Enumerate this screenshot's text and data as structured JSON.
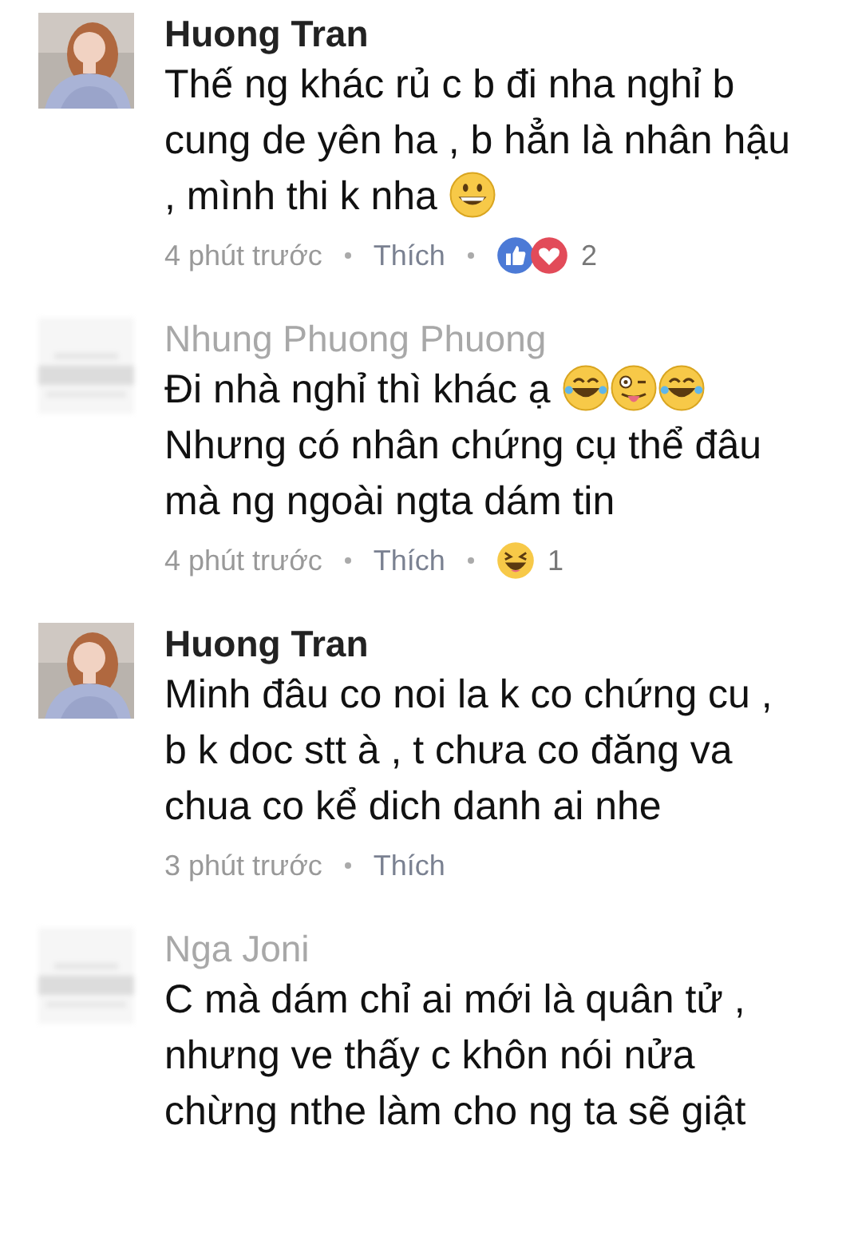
{
  "comments": [
    {
      "author": "Huong Tran",
      "blurred": false,
      "body": [
        {
          "kind": "text",
          "text": "Thế ng khác rủ c b đi nha nghỉ b cung de yên ha , b hẳn là nhân hậu , mình thi k nha "
        },
        {
          "kind": "grin"
        }
      ],
      "time": "4 phút trước",
      "like": "Thích",
      "reactions": [
        {
          "kind": "like"
        },
        {
          "kind": "love"
        }
      ],
      "count": "2"
    },
    {
      "author": "Nhung Phuong Phuong",
      "blurred": true,
      "body": [
        {
          "kind": "text",
          "text": "Đi nhà nghỉ thì khác ạ "
        },
        {
          "kind": "tears"
        },
        {
          "kind": "tongue"
        },
        {
          "kind": "tears"
        },
        {
          "kind": "text",
          "text": " Nhưng có nhân chứng cụ thể đâu mà ng ngoài ngta dám tin"
        }
      ],
      "time": "4 phút trước",
      "like": "Thích",
      "reactions": [
        {
          "kind": "haha"
        }
      ],
      "count": "1"
    },
    {
      "author": "Huong Tran",
      "blurred": false,
      "body": [
        {
          "kind": "text",
          "text": "Minh đâu co noi la k co chứng cu , b k doc stt à , t chưa co đăng va chua co kể dich danh ai nhe"
        }
      ],
      "time": "3 phút trước",
      "like": "Thích"
    },
    {
      "author": "Nga Joni",
      "blurred": true,
      "body": [
        {
          "kind": "text",
          "text": "C mà dám chỉ ai mới là quân tử , nhưng ve thấy c khôn nói nửa chừng nthe làm cho ng ta sẽ giật"
        }
      ]
    }
  ]
}
